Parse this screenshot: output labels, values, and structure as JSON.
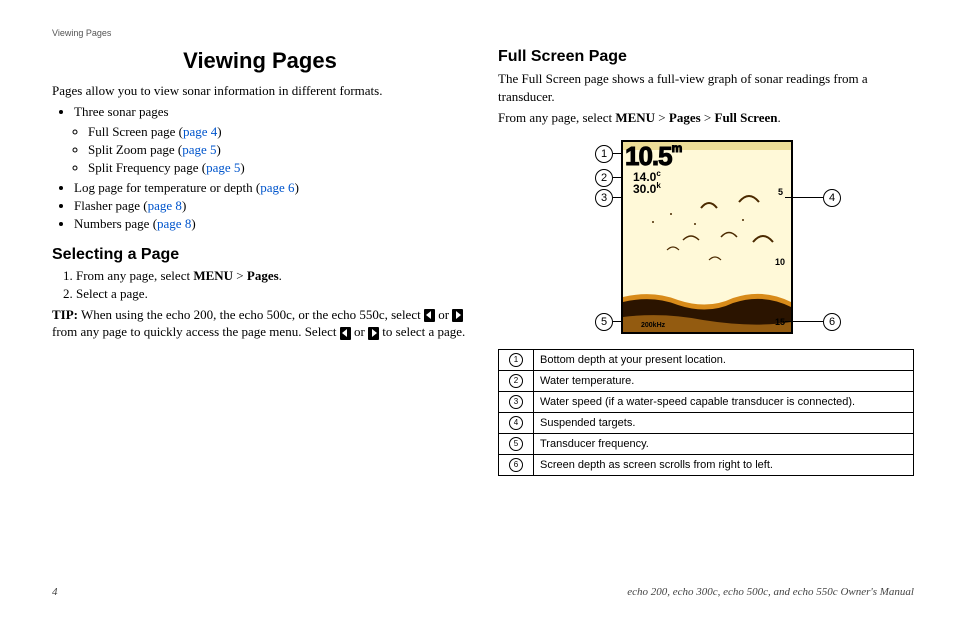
{
  "running_head": "Viewing Pages",
  "title": "Viewing Pages",
  "intro": "Pages allow you to view sonar information in different formats.",
  "bullets": {
    "b1": "Three sonar pages",
    "b1a_pre": "Full Screen page (",
    "b1a_link": "page 4",
    "b1a_post": ")",
    "b1b_pre": "Split Zoom page (",
    "b1b_link": "page 5",
    "b1b_post": ")",
    "b1c_pre": "Split Frequency page (",
    "b1c_link": "page 5",
    "b1c_post": ")",
    "b2_pre": "Log page for temperature or depth (",
    "b2_link": "page 6",
    "b2_post": ")",
    "b3_pre": "Flasher page (",
    "b3_link": "page 8",
    "b3_post": ")",
    "b4_pre": "Numbers page (",
    "b4_link": "page 8",
    "b4_post": ")"
  },
  "selecting": {
    "heading": "Selecting a Page",
    "step1_pre": "From any page, select ",
    "step1_menu": "MENU",
    "step1_gt": " > ",
    "step1_pages": "Pages",
    "step1_post": ".",
    "step2": "Select a page.",
    "tip_label": "TIP:",
    "tip_a": " When using the echo 200, the echo 500c, or the echo 550c, select ",
    "tip_b": " or ",
    "tip_c": " from any page to quickly access the page menu. Select ",
    "tip_d": " or ",
    "tip_e": " to select a page."
  },
  "fullscreen": {
    "heading": "Full Screen Page",
    "desc": "The Full Screen page shows a full-view graph of sonar readings from a transducer.",
    "instr_pre": "From any page, select ",
    "instr_menu": "MENU",
    "instr_gt1": " > ",
    "instr_pages": "Pages",
    "instr_gt2": " > ",
    "instr_full": "Full Screen",
    "instr_post": "."
  },
  "sonar": {
    "depth": "10.5",
    "depth_unit": "m",
    "temp": "14.0",
    "temp_unit": "c",
    "speed": "30.0",
    "speed_unit": "k",
    "scale5": "5",
    "scale10": "10",
    "scale15": "15",
    "freq": "200kHz"
  },
  "callouts": {
    "c1": "1",
    "c2": "2",
    "c3": "3",
    "c4": "4",
    "c5": "5",
    "c6": "6"
  },
  "legend": [
    {
      "n": "1",
      "t": "Bottom depth at your present location."
    },
    {
      "n": "2",
      "t": "Water temperature."
    },
    {
      "n": "3",
      "t": "Water speed (if a water-speed capable transducer is connected)."
    },
    {
      "n": "4",
      "t": "Suspended targets."
    },
    {
      "n": "5",
      "t": "Transducer frequency."
    },
    {
      "n": "6",
      "t": "Screen depth as screen scrolls from right to left."
    }
  ],
  "footer": {
    "page": "4",
    "credit": "echo 200, echo 300c, echo 500c, and echo 550c Owner's Manual"
  }
}
